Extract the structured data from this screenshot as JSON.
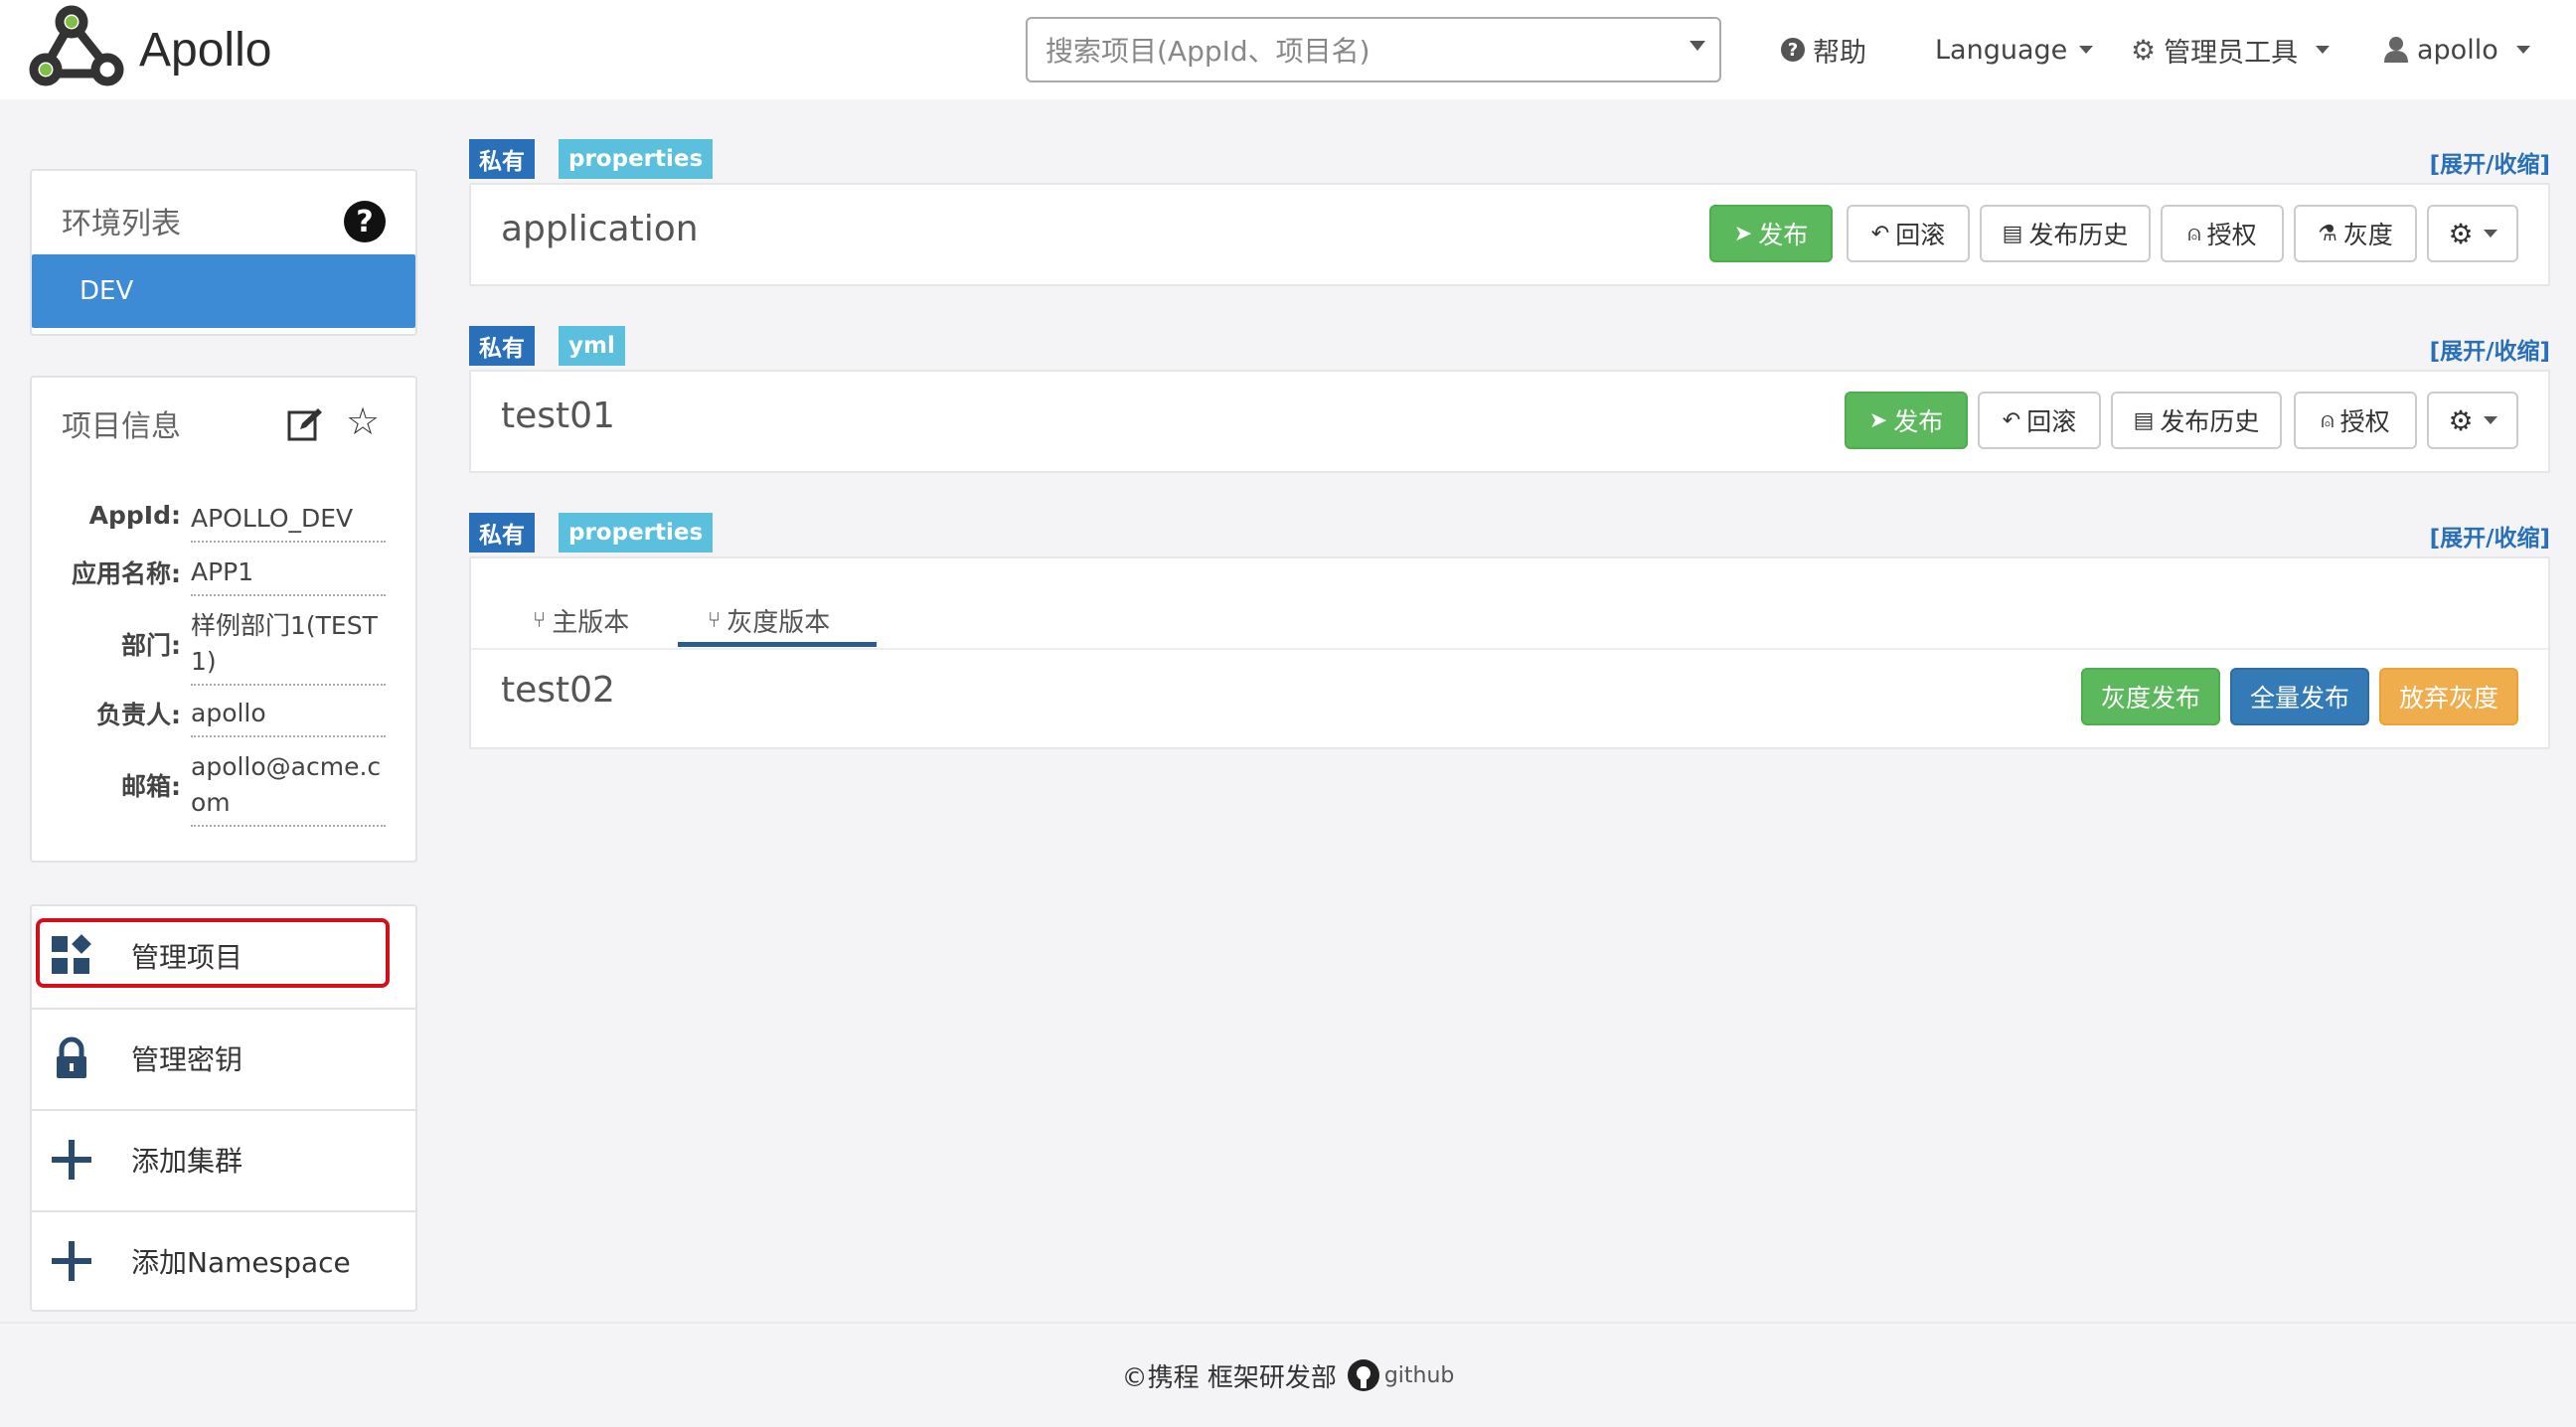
{
  "header": {
    "app_name": "Apollo",
    "search_placeholder": "搜索项目(AppId、项目名)",
    "help_label": "帮助",
    "language_label": "Language",
    "admin_tools_label": "管理员工具",
    "user_label": "apollo"
  },
  "sidebar": {
    "env_panel_title": "环境列表",
    "env_items": [
      "DEV"
    ],
    "project_panel_title": "项目信息",
    "project_info": [
      {
        "key": "AppId:",
        "value": "APOLLO_DEV"
      },
      {
        "key": "应用名称:",
        "value": "APP1"
      },
      {
        "key": "部门:",
        "value": "样例部门1(TEST1)"
      },
      {
        "key": "负责人:",
        "value": "apollo"
      },
      {
        "key": "邮箱:",
        "value": "apollo@acme.com"
      }
    ],
    "menu": [
      {
        "label": "管理项目",
        "icon": "dashboard-icon"
      },
      {
        "label": "管理密钥",
        "icon": "lock-icon"
      },
      {
        "label": "添加集群",
        "icon": "plus-icon"
      },
      {
        "label": "添加Namespace",
        "icon": "plus-icon"
      }
    ]
  },
  "namespaces": [
    {
      "scope": "私有",
      "format": "properties",
      "toggle": "[展开/收缩]",
      "name": "application",
      "buttons": [
        "发布",
        "回滚",
        "发布历史",
        "授权",
        "灰度"
      ]
    },
    {
      "scope": "私有",
      "format": "yml",
      "toggle": "[展开/收缩]",
      "name": "test01",
      "buttons": [
        "发布",
        "回滚",
        "发布历史",
        "授权"
      ]
    },
    {
      "scope": "私有",
      "format": "properties",
      "toggle": "[展开/收缩]",
      "name": "test02",
      "tabs": [
        "主版本",
        "灰度版本"
      ],
      "gray_buttons": [
        "灰度发布",
        "全量发布",
        "放弃灰度"
      ]
    }
  ],
  "footer": {
    "copyright": "©携程 框架研发部",
    "github_label": "github"
  },
  "colors": {
    "primary": "#337ab7",
    "success": "#5cb85c",
    "warning": "#f0ad4e",
    "info": "#5bc0de",
    "env_active": "#3d8bd4"
  }
}
